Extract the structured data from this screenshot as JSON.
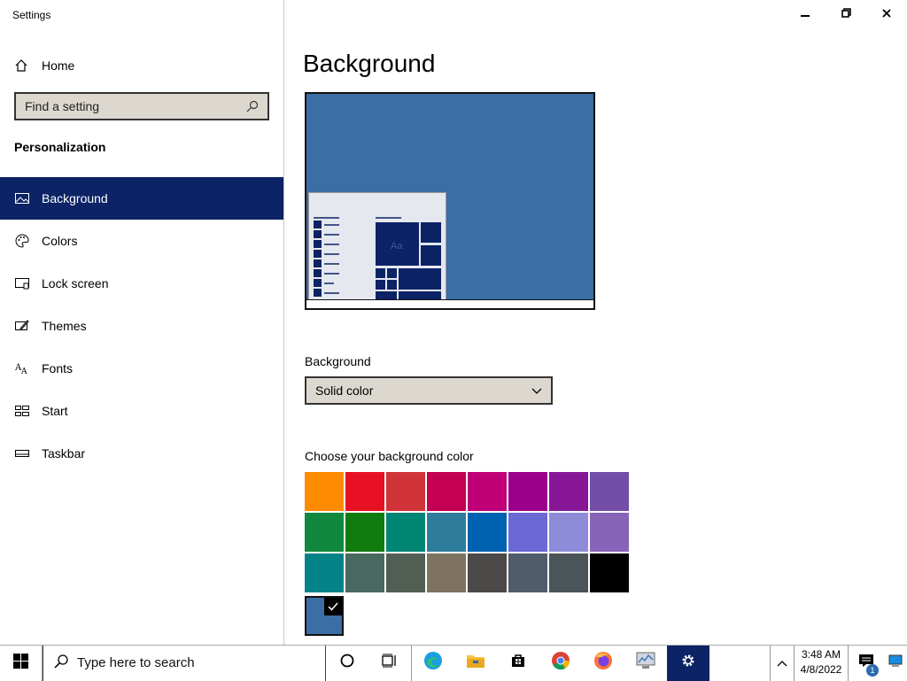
{
  "window": {
    "title": "Settings",
    "minimize_icon": "minimize-icon",
    "restore_icon": "restore-icon",
    "close_icon": "close-icon"
  },
  "sidebar": {
    "home_label": "Home",
    "search_placeholder": "Find a setting",
    "section_title": "Personalization",
    "items": [
      {
        "label": "Background",
        "icon": "image-icon",
        "active": true
      },
      {
        "label": "Colors",
        "icon": "palette-icon",
        "active": false
      },
      {
        "label": "Lock screen",
        "icon": "lock-screen-icon",
        "active": false
      },
      {
        "label": "Themes",
        "icon": "themes-icon",
        "active": false
      },
      {
        "label": "Fonts",
        "icon": "fonts-icon",
        "active": false
      },
      {
        "label": "Start",
        "icon": "start-icon",
        "active": false
      },
      {
        "label": "Taskbar",
        "icon": "taskbar-icon",
        "active": false
      }
    ]
  },
  "main": {
    "title": "Background",
    "preview_sample_text": "Aa",
    "background_label": "Background",
    "background_value": "Solid color",
    "color_label": "Choose your background color",
    "colors": [
      "#ff8c00",
      "#e81123",
      "#d13438",
      "#c30052",
      "#bf0077",
      "#9a0089",
      "#881798",
      "#744da9",
      "#10893e",
      "#107c10",
      "#018574",
      "#2d7d9a",
      "#0063b1",
      "#6b69d6",
      "#8e8cd8",
      "#8764b8",
      "#038387",
      "#486860",
      "#525e54",
      "#7e735f",
      "#4c4a48",
      "#515c6b",
      "#4a5459",
      "#000000"
    ],
    "selected_color": "#3b6ea5"
  },
  "taskbar": {
    "search_placeholder": "Type here to search",
    "time": "3:48 AM",
    "date": "4/8/2022",
    "notification_count": "1"
  },
  "colors": {
    "accent": "#0c2366",
    "desktop": "#3b6ea5"
  }
}
